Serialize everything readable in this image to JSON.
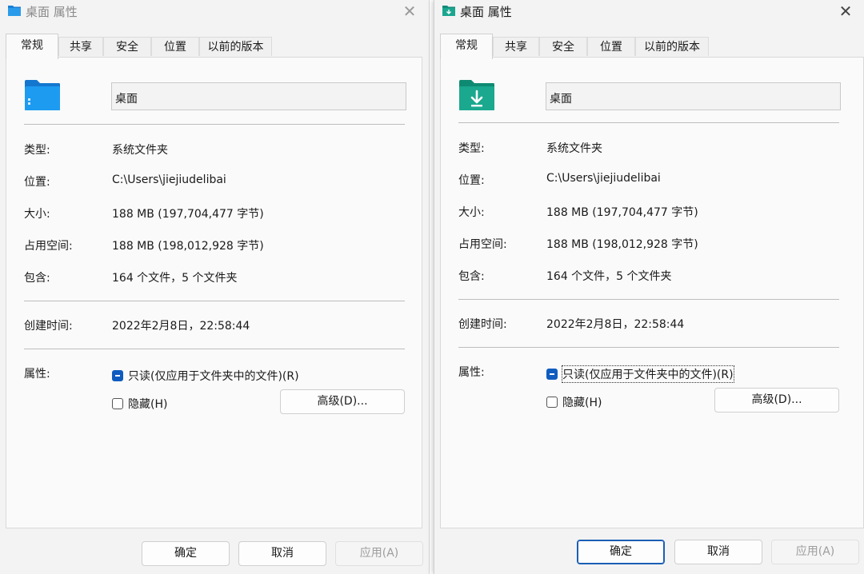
{
  "windows": [
    {
      "title": "桌面 属性",
      "tabs": [
        "常规",
        "共享",
        "安全",
        "位置",
        "以前的版本"
      ],
      "name_value": "桌面",
      "rows": [
        {
          "label": "类型:",
          "value": "系统文件夹"
        },
        {
          "label": "位置:",
          "value": "C:\\Users\\jiejiudelibai"
        },
        {
          "label": "大小:",
          "value": "188 MB (197,704,477 字节)"
        },
        {
          "label": "占用空间:",
          "value": "188 MB (198,012,928 字节)"
        },
        {
          "label": "包含:",
          "value": "164 个文件，5 个文件夹"
        }
      ],
      "created": {
        "label": "创建时间:",
        "value": "2022年2月8日，22:58:44"
      },
      "attributes": {
        "label": "属性:",
        "readonly": "只读(仅应用于文件夹中的文件)(R)",
        "hidden": "隐藏(H)",
        "advanced": "高级(D)..."
      },
      "buttons": {
        "ok": "确定",
        "cancel": "取消",
        "apply": "应用(A)"
      },
      "icon": "folder-icon",
      "title_icon": "folder-small-icon",
      "close_icon": "close-icon"
    },
    {
      "title": "桌面 属性",
      "tabs": [
        "常规",
        "共享",
        "安全",
        "位置",
        "以前的版本"
      ],
      "name_value": "桌面",
      "rows": [
        {
          "label": "类型:",
          "value": "系统文件夹"
        },
        {
          "label": "位置:",
          "value": "C:\\Users\\jiejiudelibai"
        },
        {
          "label": "大小:",
          "value": "188 MB (197,704,477 字节)"
        },
        {
          "label": "占用空间:",
          "value": "188 MB (198,012,928 字节)"
        },
        {
          "label": "包含:",
          "value": "164 个文件，5 个文件夹"
        }
      ],
      "created": {
        "label": "创建时间:",
        "value": "2022年2月8日，22:58:44"
      },
      "attributes": {
        "label": "属性:",
        "readonly": "只读(仅应用于文件夹中的文件)(R)",
        "hidden": "隐藏(H)",
        "advanced": "高级(D)..."
      },
      "buttons": {
        "ok": "确定",
        "cancel": "取消",
        "apply": "应用(A)"
      },
      "icon": "download-folder-icon",
      "title_icon": "download-folder-small-icon",
      "close_icon": "close-icon"
    }
  ],
  "colors": {
    "accent": "#0f5cc0",
    "folder_blue": "#1a8fe0",
    "folder_green": "#1a9e8a"
  }
}
